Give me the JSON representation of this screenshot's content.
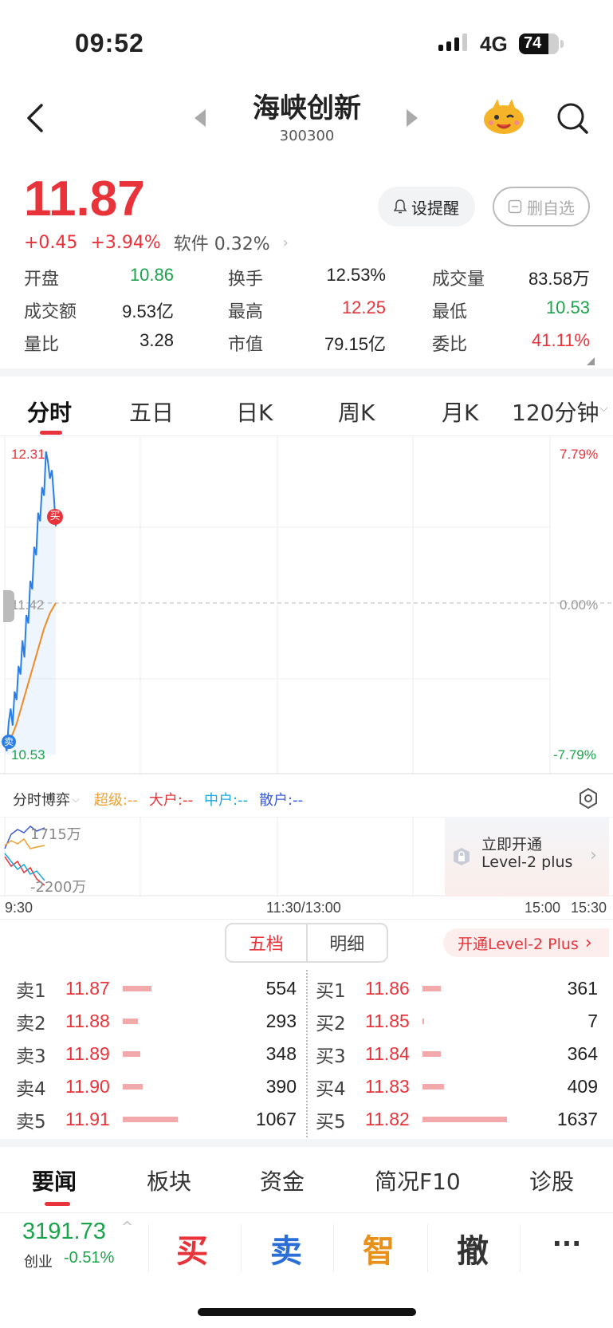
{
  "status_bar": {
    "time": "09:52",
    "network": "4G",
    "battery": "74",
    "battery_level": 0.74
  },
  "header": {
    "name": "海峡创新",
    "code": "300300"
  },
  "quote": {
    "price": "11.87",
    "change": "+0.45",
    "change_pct": "+3.94%",
    "sector": "软件 0.32%",
    "alert_label": "设提醒",
    "remove_label": "删自选"
  },
  "stats": [
    [
      {
        "label": "开盘",
        "value": "10.86",
        "color": "green"
      },
      {
        "label": "换手",
        "value": "12.53%",
        "color": "dark"
      },
      {
        "label": "成交量",
        "value": "83.58万",
        "color": "dark"
      }
    ],
    [
      {
        "label": "成交额",
        "value": "9.53亿",
        "color": "dark"
      },
      {
        "label": "最高",
        "value": "12.25",
        "color": "red"
      },
      {
        "label": "最低",
        "value": "10.53",
        "color": "green"
      }
    ],
    [
      {
        "label": "量比",
        "value": "3.28",
        "color": "dark"
      },
      {
        "label": "市值",
        "value": "79.15亿",
        "color": "dark"
      },
      {
        "label": "委比",
        "value": "41.11%",
        "color": "red"
      }
    ]
  ],
  "tabs": [
    "分时",
    "五日",
    "日K",
    "周K",
    "月K",
    "120分钟"
  ],
  "chart_data": {
    "type": "line",
    "y_high": "12.31",
    "y_mid": "11.42",
    "y_low": "10.53",
    "pct_high": "7.79%",
    "pct_mid": "0.00%",
    "pct_low": "-7.79%",
    "ylim": [
      10.53,
      12.31
    ],
    "buy_marker": "买",
    "sell_marker": "卖",
    "series": [
      {
        "name": "price",
        "values": [
          10.6,
          10.55,
          10.72,
          10.8,
          10.7,
          10.9,
          10.85,
          11.05,
          11.0,
          11.2,
          11.1,
          11.35,
          11.3,
          11.55,
          11.5,
          11.75,
          11.7,
          11.95,
          11.9,
          12.1,
          12.05,
          12.31,
          12.25,
          12.15,
          12.2,
          12.05,
          11.87
        ]
      },
      {
        "name": "average",
        "values": [
          10.6,
          10.58,
          10.6,
          10.63,
          10.65,
          10.68,
          10.71,
          10.75,
          10.79,
          10.83,
          10.87,
          10.91,
          10.95,
          10.99,
          11.03,
          11.07,
          11.11,
          11.15,
          11.19,
          11.23,
          11.27,
          11.3,
          11.33,
          11.36,
          11.38,
          11.4,
          11.42
        ]
      }
    ]
  },
  "flow": {
    "title": "分时博弈",
    "super": "超级:--",
    "large": "大户:--",
    "mid": "中户:--",
    "retail": "散户:--",
    "top_value": "1715万",
    "bottom_value": "-2200万",
    "card_title": "立即开通",
    "card_sub": "Level-2 plus",
    "colors": {
      "super": "#f0a030",
      "large": "#e8333a",
      "mid": "#1aa7e0",
      "retail": "#3b5bdb"
    }
  },
  "time_axis": {
    "start": "9:30",
    "mid": "11:30/13:00",
    "t1500": "15:00",
    "end": "15:30"
  },
  "orderbook": {
    "seg_left": "五档",
    "seg_right": "明细",
    "level2_link": "开通Level-2 Plus",
    "sells": [
      {
        "label": "卖1",
        "price": "11.87",
        "vol": "554",
        "bar": 0.34
      },
      {
        "label": "卖2",
        "price": "11.88",
        "vol": "293",
        "bar": 0.18
      },
      {
        "label": "卖3",
        "price": "11.89",
        "vol": "348",
        "bar": 0.21
      },
      {
        "label": "卖4",
        "price": "11.90",
        "vol": "390",
        "bar": 0.24
      },
      {
        "label": "卖5",
        "price": "11.91",
        "vol": "1067",
        "bar": 0.65
      }
    ],
    "buys": [
      {
        "label": "买1",
        "price": "11.86",
        "vol": "361",
        "bar": 0.22
      },
      {
        "label": "买2",
        "price": "11.85",
        "vol": "7",
        "bar": 0.01
      },
      {
        "label": "买3",
        "price": "11.84",
        "vol": "364",
        "bar": 0.22
      },
      {
        "label": "买4",
        "price": "11.83",
        "vol": "409",
        "bar": 0.25
      },
      {
        "label": "买5",
        "price": "11.82",
        "vol": "1637",
        "bar": 1.0
      }
    ]
  },
  "news_tabs": [
    "要闻",
    "板块",
    "资金",
    "简况F10",
    "诊股"
  ],
  "bottom": {
    "index_value": "3191.73",
    "index_name": "创业",
    "index_change": "-0.51%",
    "buy": "买",
    "sell": "卖",
    "smart": "智",
    "cancel": "撤",
    "more": "···"
  }
}
